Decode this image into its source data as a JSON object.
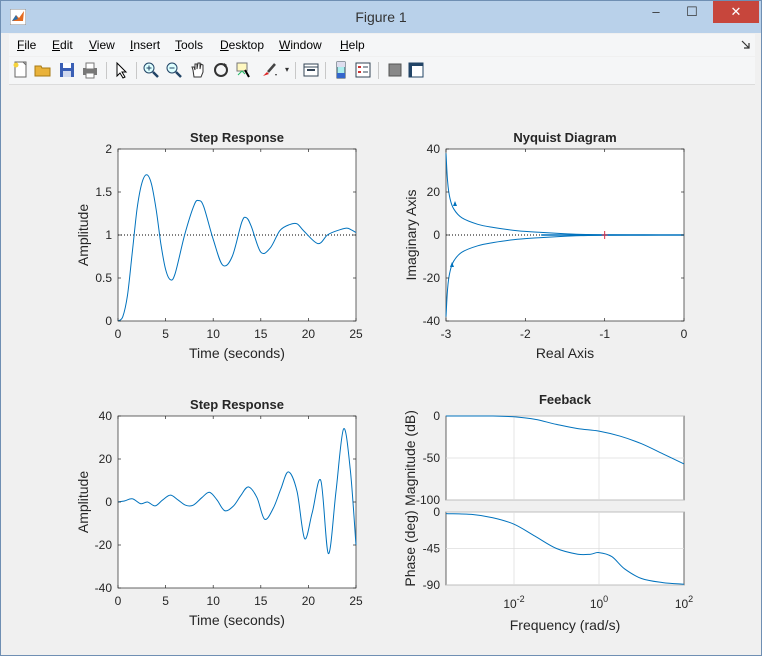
{
  "window": {
    "title": "Figure 1",
    "minimize": "–",
    "maximize": "☐",
    "close": "✕"
  },
  "menu": [
    "File",
    "Edit",
    "View",
    "Insert",
    "Tools",
    "Desktop",
    "Window",
    "Help"
  ],
  "menu_mnemonics": [
    "F",
    "E",
    "V",
    "I",
    "T",
    "D",
    "W",
    "H"
  ],
  "toolbar": [
    "new-figure-icon",
    "open-file-icon",
    "save-icon",
    "print-icon",
    "pointer-icon",
    "zoom-in-icon",
    "zoom-out-icon",
    "pan-icon",
    "rotate-icon",
    "data-cursor-icon",
    "brush-icon",
    "link-plot-icon",
    "colorbar-icon",
    "legend-icon",
    "hide-plot-tools-icon",
    "show-plot-tools-icon"
  ],
  "chart_data": [
    {
      "type": "line",
      "title": "Step Response",
      "xlabel": "Time (seconds)",
      "ylabel": "Amplitude",
      "xlim": [
        0,
        25
      ],
      "ylim": [
        0,
        2
      ],
      "xticks": [
        "0",
        "5",
        "10",
        "15",
        "20",
        "25"
      ],
      "yticks": [
        "0",
        "0.5",
        "1",
        "1.5",
        "2"
      ],
      "reference_line": 1,
      "series": [
        {
          "x": [
            0,
            0.5,
            1,
            1.5,
            2,
            2.5,
            3,
            3.5,
            4,
            4.5,
            5,
            5.5,
            6,
            7,
            8,
            8.5,
            9,
            10,
            11,
            12,
            13,
            13.5,
            14,
            15,
            16,
            17,
            18,
            18.8,
            19.5,
            21,
            22,
            23,
            24,
            24.5,
            25
          ],
          "y": [
            0,
            0.05,
            0.3,
            0.8,
            1.3,
            1.6,
            1.7,
            1.6,
            1.3,
            0.9,
            0.6,
            0.48,
            0.55,
            1.0,
            1.35,
            1.4,
            1.33,
            0.95,
            0.65,
            0.75,
            1.15,
            1.2,
            1.1,
            0.8,
            0.85,
            1.05,
            1.12,
            1.13,
            1.05,
            0.9,
            1.0,
            1.05,
            1.08,
            1.06,
            1.03
          ]
        }
      ]
    },
    {
      "type": "line",
      "title": "Nyquist Diagram",
      "xlabel": "Real Axis",
      "ylabel": "Imaginary Axis",
      "xlim": [
        -3,
        0
      ],
      "ylim": [
        -40,
        40
      ],
      "xticks": [
        "-3",
        "-2",
        "-1",
        "0"
      ],
      "yticks": [
        "-40",
        "-20",
        "0",
        "20",
        "40"
      ],
      "critical_point": [
        -1,
        0
      ],
      "series": [
        {
          "x": [
            -3,
            -2.98,
            -2.95,
            -2.9,
            -2.8,
            -2.6,
            -2.4,
            -2.1,
            -1.8,
            -1.5,
            -1.3,
            -1.0,
            -0.5,
            0
          ],
          "y": [
            38,
            25,
            17,
            12,
            8,
            5,
            3.5,
            2,
            1.2,
            0.6,
            0.3,
            0.1,
            0.03,
            0
          ]
        },
        {
          "x": [
            -3,
            -2.98,
            -2.95,
            -2.9,
            -2.8,
            -2.6,
            -2.4,
            -2.1,
            -1.8,
            -1.5,
            -1.3,
            -1.0,
            -0.5,
            0
          ],
          "y": [
            -38,
            -25,
            -17,
            -12,
            -8,
            -5,
            -3.5,
            -2,
            -1.2,
            -0.6,
            -0.3,
            -0.1,
            -0.03,
            0
          ]
        }
      ]
    },
    {
      "type": "line",
      "title": "Step Response",
      "xlabel": "Time (seconds)",
      "ylabel": "Amplitude",
      "xlim": [
        0,
        25
      ],
      "ylim": [
        -40,
        40
      ],
      "xticks": [
        "0",
        "5",
        "10",
        "15",
        "20",
        "25"
      ],
      "yticks": [
        "-40",
        "-20",
        "0",
        "20",
        "40"
      ],
      "series": [
        {
          "x": [
            0,
            0.7,
            1.5,
            2.4,
            3.1,
            3.9,
            4.7,
            5.5,
            6.3,
            7.1,
            7.9,
            8.8,
            9.6,
            10.4,
            11.2,
            12.1,
            12.9,
            13.7,
            14.6,
            15.4,
            16.3,
            17.1,
            17.9,
            18.8,
            19.6,
            20.4,
            21.3,
            22.1,
            22.9,
            23.7,
            24.4,
            25
          ],
          "y": [
            0,
            0.5,
            1.5,
            -0.8,
            0,
            -1.8,
            1,
            3.2,
            1,
            -1.5,
            -1.5,
            2,
            4.5,
            1,
            -4,
            -2,
            3,
            7,
            2,
            -8,
            -3,
            6,
            14,
            5,
            -17,
            -5,
            10,
            -24,
            5,
            34,
            15,
            -20
          ]
        }
      ]
    },
    {
      "type": "line",
      "title": "Feeback",
      "xlabel": "Frequency  (rad/s)",
      "subplots": [
        {
          "ylabel": "Magnitude (dB)",
          "ylim": [
            -100,
            0
          ],
          "yticks": [
            "-100",
            "-50",
            "0"
          ],
          "grid": true,
          "series": [
            {
              "logx": [
                -3.6,
                -3,
                -2.5,
                -2,
                -1.5,
                -1,
                -0.5,
                0,
                0.5,
                1,
                1.5,
                2
              ],
              "y": [
                0,
                0,
                0,
                -1,
                -4,
                -10,
                -15,
                -18,
                -24,
                -33,
                -45,
                -57
              ]
            }
          ]
        },
        {
          "ylabel": "Phase (deg)",
          "ylim": [
            -90,
            0
          ],
          "yticks": [
            "-90",
            "-45",
            "0"
          ],
          "grid": true,
          "series": [
            {
              "logx": [
                -3.6,
                -3,
                -2.5,
                -2,
                -1.5,
                -1,
                -0.5,
                -0.2,
                0,
                0.3,
                0.6,
                1,
                1.5,
                2
              ],
              "y": [
                -2,
                -3,
                -7,
                -15,
                -30,
                -45,
                -52,
                -52,
                -50,
                -55,
                -70,
                -82,
                -87,
                -89
              ]
            }
          ]
        }
      ],
      "xlim_log": [
        -3.6,
        2
      ],
      "xticks": [
        {
          "base": "10",
          "exp": "-2"
        },
        {
          "base": "10",
          "exp": "0"
        },
        {
          "base": "10",
          "exp": "2"
        }
      ]
    }
  ],
  "colors": {
    "line": "#0072bd",
    "critical": "#d9324a",
    "titlebar": "#b9d1ea"
  }
}
